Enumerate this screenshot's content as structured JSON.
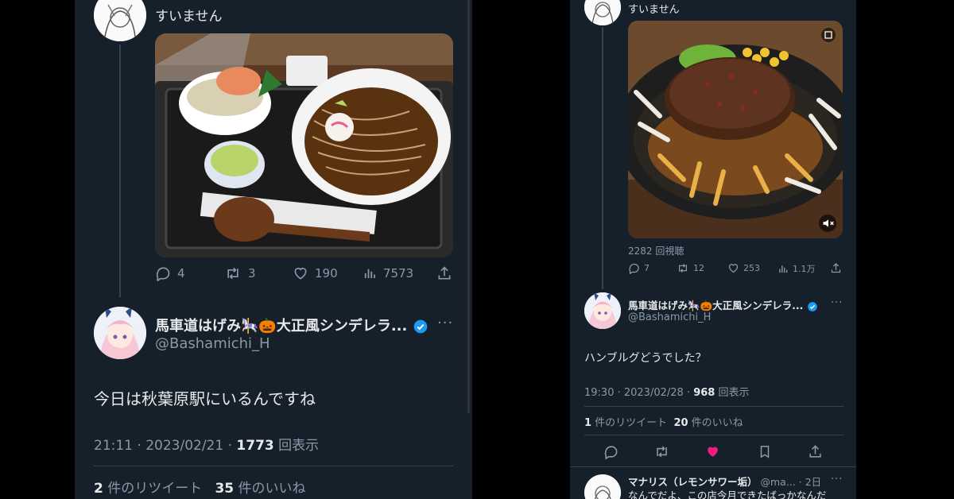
{
  "left": {
    "prev_tweet_text": "すいません",
    "prev_actions": {
      "reply": "4",
      "retweet": "3",
      "like": "190",
      "views": "7573"
    },
    "author": {
      "name": "馬車道はげみ🎠🎃大正風シンデレラ...",
      "handle": "@Bashamichi_H"
    },
    "body": "今日は秋葉原駅にいるんですね",
    "meta": {
      "time": "21:11 · 2023/02/21 · ",
      "views": "1773",
      "views_suffix": " 回表示"
    },
    "stats": {
      "rt_count": "2",
      "rt_label": " 件のリツイート",
      "like_count": "35",
      "like_label": " 件のいいね"
    }
  },
  "right": {
    "prev_tweet_text": "すいません",
    "video_views": "2282 回視聴",
    "prev_actions": {
      "reply": "7",
      "retweet": "12",
      "like": "253",
      "views": "1.1万"
    },
    "author": {
      "name": "馬車道はげみ🎠🎃大正風シンデレラ...",
      "handle": "@Bashamichi_H"
    },
    "body": "ハンブルグどうでした？",
    "meta": {
      "time": "19:30 · 2023/02/28 · ",
      "views": "968",
      "views_suffix": " 回表示"
    },
    "stats": {
      "rt_count": "1",
      "rt_label": " 件のリツイート",
      "like_count": "20",
      "like_label": " 件のいいね"
    },
    "reply": {
      "name": "マナリス（レモンサワー垢）",
      "handle": "@ma...",
      "time": "· 2日",
      "text": "なんでだよ、この店今月できたばっかなんだ"
    }
  },
  "colors": {
    "bg": "#15202b",
    "text": "#e7e9ea",
    "muted": "#8b98a5",
    "verified": "#1d9bf0",
    "like": "#f91880"
  }
}
